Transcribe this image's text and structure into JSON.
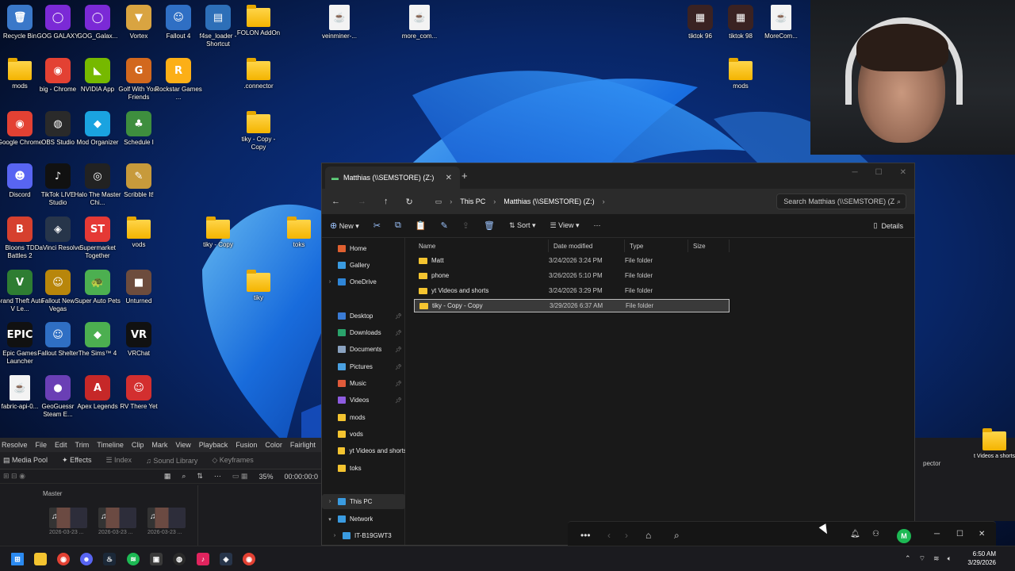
{
  "desktop": {
    "icons": [
      {
        "label": "Recycle Bin",
        "glyph": "🗑",
        "color": "#3a78c9"
      },
      {
        "label": "GOG GALAXY",
        "glyph": "◯",
        "color": "#7b2ad6"
      },
      {
        "label": "GOG_Galax...",
        "glyph": "◯",
        "color": "#7b2ad6"
      },
      {
        "label": "Vortex",
        "glyph": "▼",
        "color": "#d9a441"
      },
      {
        "label": "Fallout 4",
        "glyph": "☺",
        "color": "#2f6fc4"
      },
      {
        "label": "f4se_loader - Shortcut",
        "glyph": "▤",
        "color": "#2d6fb8"
      },
      {
        "label": "FOLON AddOn",
        "glyph": "folder",
        "color": "#f4b400"
      },
      {
        "label": "veinminer-...",
        "glyph": "java",
        "color": "#f3f3f3"
      },
      {
        "label": "more_com...",
        "glyph": "java",
        "color": "#f3f3f3"
      },
      {
        "label": "tiktok 96",
        "glyph": "▦",
        "color": "#3a2222"
      },
      {
        "label": "tiktok 98",
        "glyph": "▦",
        "color": "#3a2222"
      },
      {
        "label": "MoreCom...",
        "glyph": "java",
        "color": "#f3f3f3"
      },
      {
        "label": "mods",
        "glyph": "folder",
        "color": "#f4b400"
      },
      {
        "label": "big - Chrome",
        "glyph": "◉",
        "color": "#e34133"
      },
      {
        "label": "NVIDIA App",
        "glyph": "◣",
        "color": "#76b900"
      },
      {
        "label": "Golf With Your Friends",
        "glyph": "G",
        "color": "#d2681e"
      },
      {
        "label": "Rockstar Games ...",
        "glyph": "R",
        "color": "#fcaf17"
      },
      {
        "label": ".connector",
        "glyph": "folder",
        "color": "#f4b400"
      },
      {
        "label": "mods",
        "glyph": "folder",
        "color": "#f4b400"
      },
      {
        "label": "Google Chrome",
        "glyph": "◉",
        "color": "#e34133"
      },
      {
        "label": "OBS Studio",
        "glyph": "◍",
        "color": "#2a2a2a"
      },
      {
        "label": "Mod Organizer",
        "glyph": "◆",
        "color": "#1aa3e0"
      },
      {
        "label": "Schedule I",
        "glyph": "♣",
        "color": "#3e8e3e"
      },
      {
        "label": "tiky - Copy - Copy",
        "glyph": "folder",
        "color": "#f4b400"
      },
      {
        "label": "Discord",
        "glyph": "☻",
        "color": "#5865f2"
      },
      {
        "label": "TikTok LIVE Studio",
        "glyph": "♪",
        "color": "#111111"
      },
      {
        "label": "Halo The Master Chi...",
        "glyph": "◎",
        "color": "#222222"
      },
      {
        "label": "Scribble It!",
        "glyph": "✎",
        "color": "#c79a3b"
      },
      {
        "label": "tiky - Copy",
        "glyph": "folder",
        "color": "#f4b400"
      },
      {
        "label": "toks",
        "glyph": "folder",
        "color": "#f4b400"
      },
      {
        "label": "Bloons TD Battles 2",
        "glyph": "B",
        "color": "#d6402e"
      },
      {
        "label": "DaVinci Resolve",
        "glyph": "◈",
        "color": "#27354a"
      },
      {
        "label": "Supermarket Together",
        "glyph": "ST",
        "color": "#e53935"
      },
      {
        "label": "vods",
        "glyph": "folder",
        "color": "#f4b400"
      },
      {
        "label": "tiky",
        "glyph": "folder",
        "color": "#f4b400"
      },
      {
        "label": "Grand Theft Auto V Le...",
        "glyph": "V",
        "color": "#2e7d32"
      },
      {
        "label": "Fallout New Vegas",
        "glyph": "☺",
        "color": "#b8860b"
      },
      {
        "label": "Super Auto Pets",
        "glyph": "🐢",
        "color": "#4caf50"
      },
      {
        "label": "Unturned",
        "glyph": "■",
        "color": "#6d4c3d"
      },
      {
        "label": "Epic Games Launcher",
        "glyph": "EPIC",
        "color": "#111111"
      },
      {
        "label": "Fallout Shelter",
        "glyph": "☺",
        "color": "#2f6fc4"
      },
      {
        "label": "The Sims™ 4",
        "glyph": "◆",
        "color": "#4caf50"
      },
      {
        "label": "VRChat",
        "glyph": "VR",
        "color": "#111111"
      },
      {
        "label": "fabric-api-0...",
        "glyph": "java",
        "color": "#f3f3f3"
      },
      {
        "label": "GeoGuessr Steam E...",
        "glyph": "●",
        "color": "#6a3fb5"
      },
      {
        "label": "Apex Legends",
        "glyph": "A",
        "color": "#c62828"
      },
      {
        "label": "RV There Yet",
        "glyph": "☺",
        "color": "#d32f2f"
      }
    ]
  },
  "resolve": {
    "menu": [
      "Resolve",
      "File",
      "Edit",
      "Trim",
      "Timeline",
      "Clip",
      "Mark",
      "View",
      "Playback",
      "Fusion",
      "Color",
      "Fairlight"
    ],
    "toolbar": {
      "media_pool": "Media Pool",
      "effects": "Effects",
      "index": "Index",
      "sound_library": "Sound Library",
      "keyframes": "Keyframes"
    },
    "zoom": "35%",
    "timecode": "00:00:00:0",
    "master_label": "Master",
    "clips": [
      "2026-03-23 ...",
      "2026-03-23 ...",
      "2026-03-23 ..."
    ]
  },
  "explorer": {
    "tab_title": "Matthias (\\\\SEMSTORE) (Z:)",
    "breadcrumbs": [
      "This PC",
      "Matthias (\\\\SEMSTORE) (Z:)"
    ],
    "search_placeholder": "Search Matthias (\\\\SEMSTORE) (Z:)",
    "commands": {
      "new": "New",
      "sort": "Sort",
      "view": "View",
      "details": "Details"
    },
    "nav": [
      {
        "label": "Home",
        "icon": "home-icon",
        "color": "#e06030",
        "pinned": false,
        "expand": false
      },
      {
        "label": "Gallery",
        "icon": "gallery-icon",
        "color": "#3a9be0",
        "pinned": false,
        "expand": false
      },
      {
        "label": "OneDrive",
        "icon": "cloud-icon",
        "color": "#2f86d8",
        "pinned": false,
        "expand": true
      },
      {
        "label": "Desktop",
        "icon": "desktop-icon",
        "color": "#3a7bd5",
        "pinned": true,
        "expand": false
      },
      {
        "label": "Downloads",
        "icon": "download-icon",
        "color": "#2aa36b",
        "pinned": true,
        "expand": false
      },
      {
        "label": "Documents",
        "icon": "document-icon",
        "color": "#8aa2c0",
        "pinned": true,
        "expand": false
      },
      {
        "label": "Pictures",
        "icon": "pictures-icon",
        "color": "#4aa0e0",
        "pinned": true,
        "expand": false
      },
      {
        "label": "Music",
        "icon": "music-icon",
        "color": "#e05a3a",
        "pinned": true,
        "expand": false
      },
      {
        "label": "Videos",
        "icon": "videos-icon",
        "color": "#8e5ce0",
        "pinned": true,
        "expand": false
      },
      {
        "label": "mods",
        "icon": "folder-icon",
        "color": "#f4c430",
        "pinned": false,
        "expand": false
      },
      {
        "label": "vods",
        "icon": "folder-icon",
        "color": "#f4c430",
        "pinned": false,
        "expand": false
      },
      {
        "label": "yt Videos and shorts",
        "icon": "folder-icon",
        "color": "#f4c430",
        "pinned": false,
        "expand": false
      },
      {
        "label": "toks",
        "icon": "folder-icon",
        "color": "#f4c430",
        "pinned": false,
        "expand": false
      },
      {
        "label": "This PC",
        "icon": "pc-icon",
        "color": "#3a9be0",
        "pinned": false,
        "expand": true
      },
      {
        "label": "Network",
        "icon": "network-icon",
        "color": "#3a9be0",
        "pinned": false,
        "expand": true
      },
      {
        "label": "IT-B19GWT3",
        "icon": "monitor-icon",
        "color": "#3a9be0",
        "pinned": false,
        "expand": true
      }
    ],
    "columns": {
      "name": "Name",
      "date": "Date modified",
      "type": "Type",
      "size": "Size"
    },
    "files": [
      {
        "name": "Matt",
        "date": "3/24/2026 3:24 PM",
        "type": "File folder"
      },
      {
        "name": "phone",
        "date": "3/26/2026 5:10 PM",
        "type": "File folder"
      },
      {
        "name": "yt Videos and shorts",
        "date": "3/24/2026 3:29 PM",
        "type": "File folder"
      },
      {
        "name": "tiky - Copy - Copy",
        "date": "3/29/2026 6:37 AM",
        "type": "File folder"
      }
    ],
    "selected_file_index": 3
  },
  "right_remnants": {
    "label1": "pector",
    "folder_label": "t Videos a shorts"
  },
  "floatbar": {
    "avatar_letter": "M"
  },
  "taskbar": {
    "time": "6:50 AM",
    "date": "3/29/2026"
  }
}
